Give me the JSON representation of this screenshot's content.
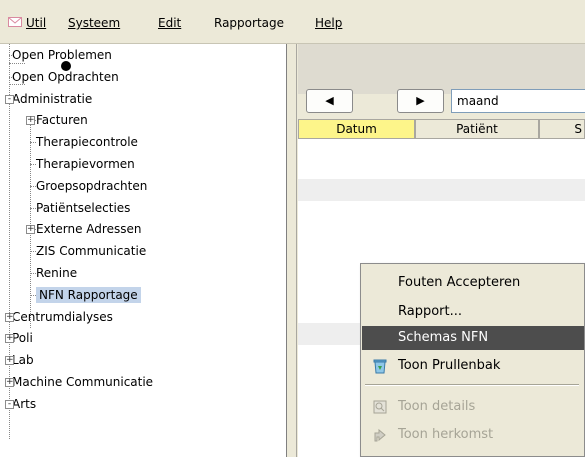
{
  "menubar": {
    "util": "Util",
    "systeem": "Systeem",
    "edit": "Edit",
    "rapportage": "Rapportage",
    "help": "Help"
  },
  "tree": [
    {
      "label": "Open Problemen",
      "expander": null
    },
    {
      "label": "Open Opdrachten",
      "expander": null
    },
    {
      "label": "Administratie",
      "expander": "-"
    },
    {
      "label": "Facturen",
      "expander": "+"
    },
    {
      "label": "Therapiecontrole",
      "expander": null
    },
    {
      "label": "Therapievormen",
      "expander": null
    },
    {
      "label": "Groepsopdrachten",
      "expander": null
    },
    {
      "label": "Patiëntselecties",
      "expander": null
    },
    {
      "label": "Externe Adressen",
      "expander": "+"
    },
    {
      "label": "ZIS Communicatie",
      "expander": null
    },
    {
      "label": "Renine",
      "expander": null
    },
    {
      "label": "NFN Rapportage",
      "expander": null,
      "selected": true
    },
    {
      "label": "Centrumdialyses",
      "expander": "+"
    },
    {
      "label": "Poli",
      "expander": "+"
    },
    {
      "label": "Lab",
      "expander": "+"
    },
    {
      "label": "Machine Communicatie",
      "expander": "+"
    },
    {
      "label": "Arts",
      "expander": "-"
    }
  ],
  "toolbar": {
    "prev_glyph": "◀",
    "next_glyph": "▶",
    "period_value": "maand"
  },
  "grid": {
    "columns": [
      "Datum",
      "Patiënt",
      "S"
    ]
  },
  "context_menu": {
    "items": [
      {
        "label": "Fouten Accepteren",
        "icon": null,
        "state": "normal"
      },
      {
        "label": "Rapport...",
        "icon": null,
        "state": "normal"
      },
      {
        "label": "Schemas NFN",
        "icon": null,
        "state": "highlighted"
      },
      {
        "label": "Toon Prullenbak",
        "icon": "recycle-bin-icon",
        "state": "normal"
      },
      {
        "label": "Toon details",
        "icon": "details-icon",
        "state": "disabled"
      },
      {
        "label": "Toon herkomst",
        "icon": "origin-icon",
        "state": "disabled"
      }
    ]
  },
  "colors": {
    "highlight": "#4d4d4d",
    "selected_tree": "#c3d4ea",
    "active_column": "#fdf58a"
  }
}
